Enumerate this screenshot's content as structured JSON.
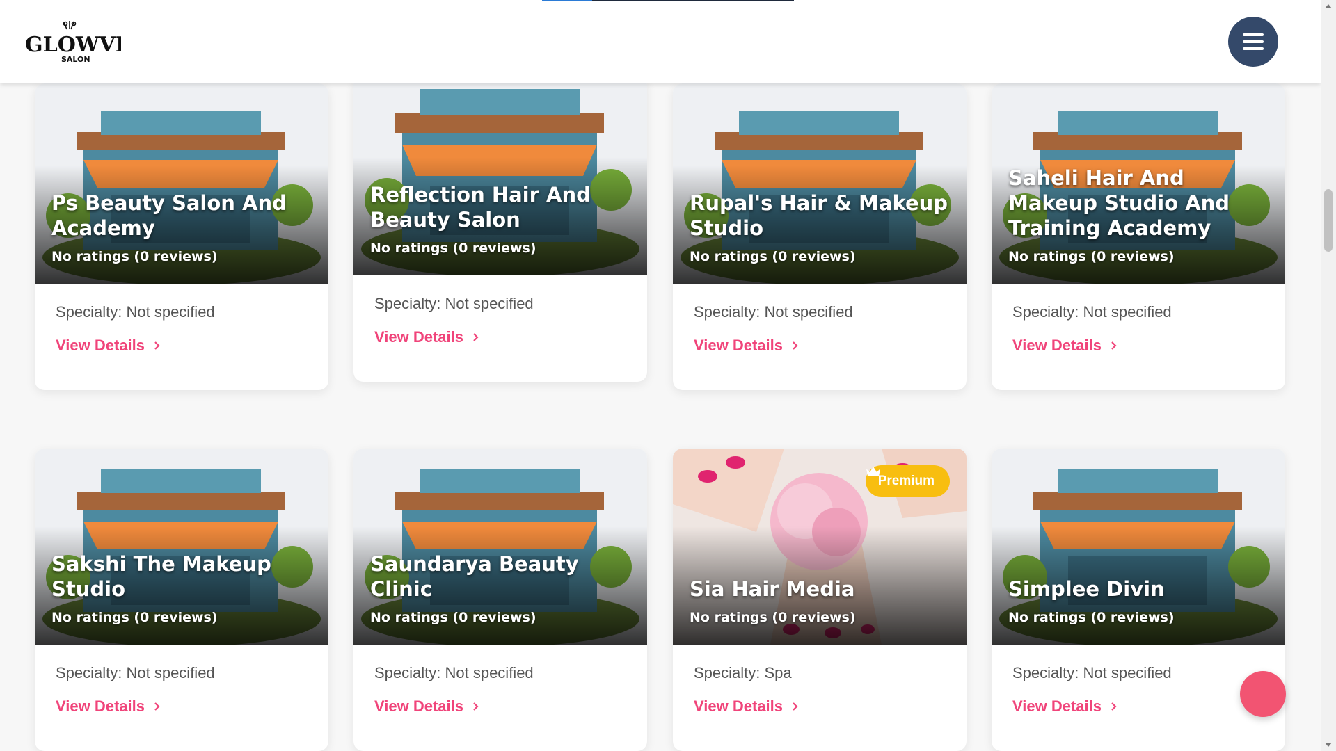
{
  "header": {
    "logo_text": "GLOWVITA",
    "logo_subtext": "SALON",
    "menu_icon": "hamburger-icon",
    "progress_fraction": 0.2
  },
  "cards": [
    {
      "name": "Ps Beauty Salon And Academy",
      "rating": "No ratings (0 reviews)",
      "specialty": "Specialty: Not specified",
      "link": "View Details",
      "image": "salon-illustration"
    },
    {
      "name": "Reflection Hair And Beauty Salon",
      "rating": "No ratings (0 reviews)",
      "specialty": "Specialty: Not specified",
      "link": "View Details",
      "image": "salon-illustration"
    },
    {
      "name": "Rupal's Hair & Makeup Studio",
      "rating": "No ratings (0 reviews)",
      "specialty": "Specialty: Not specified",
      "link": "View Details",
      "image": "salon-illustration"
    },
    {
      "name": "Saheli Hair And Makeup Studio And Training Academy",
      "rating": "No ratings (0 reviews)",
      "specialty": "Specialty: Not specified",
      "link": "View Details",
      "image": "salon-illustration"
    },
    {
      "name": "Sakshi The Makeup Studio",
      "rating": "No ratings (0 reviews)",
      "specialty": "Specialty: Not specified",
      "link": "View Details",
      "image": "salon-illustration"
    },
    {
      "name": "Saundarya Beauty Clinic",
      "rating": "No ratings (0 reviews)",
      "specialty": "Specialty: Not specified",
      "link": "View Details",
      "image": "salon-illustration"
    },
    {
      "name": "Sia Hair Media",
      "rating": "No ratings (0 reviews)",
      "specialty": "Specialty: Spa",
      "link": "View Details",
      "image": "spa-photo",
      "badge": "Premium"
    },
    {
      "name": "Simplee Divin",
      "rating": "No ratings (0 reviews)",
      "specialty": "Specialty: Not specified",
      "link": "View Details",
      "image": "salon-illustration"
    }
  ],
  "colors": {
    "accent": "#f0447a",
    "menu_button": "#34496a",
    "premium_badge": "#f8be10",
    "fab": "#f25472"
  }
}
